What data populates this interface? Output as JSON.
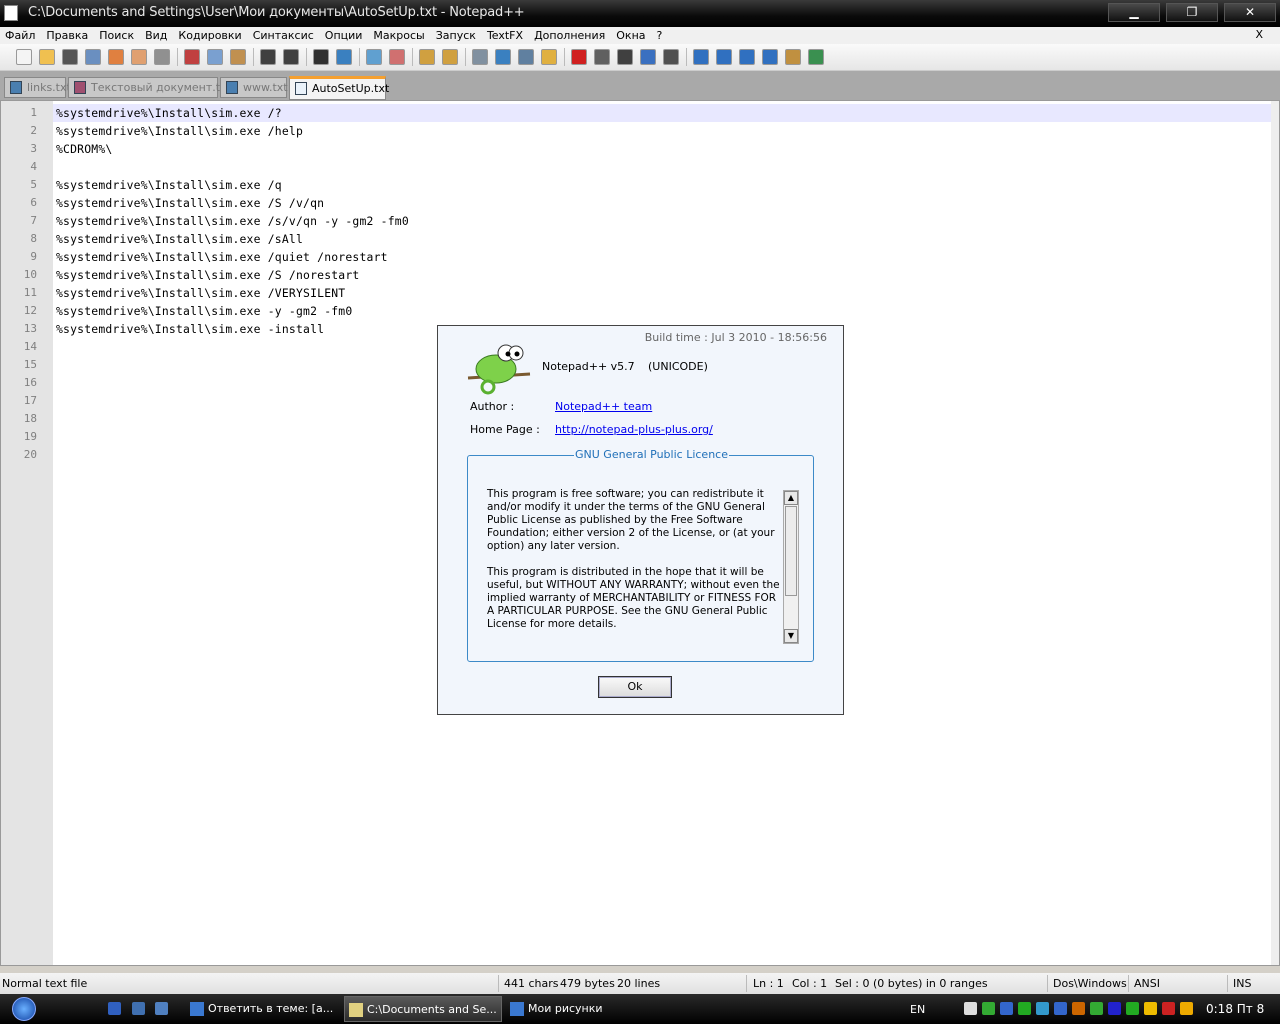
{
  "window": {
    "title": "C:\\Documents and Settings\\User\\Мои документы\\AutoSetUp.txt - Notepad++",
    "minimize": "▁",
    "maximize": "❐",
    "close": "✕"
  },
  "menu": {
    "items": [
      "Файл",
      "Правка",
      "Поиск",
      "Вид",
      "Кодировки",
      "Синтаксис",
      "Опции",
      "Макросы",
      "Запуск",
      "TextFX",
      "Дополнения",
      "Окна",
      "?"
    ],
    "close": "X"
  },
  "toolbar": {
    "icons": [
      {
        "name": "new-file-icon",
        "color": "#f4f4f4"
      },
      {
        "name": "open-file-icon",
        "color": "#f0c050"
      },
      {
        "name": "save-icon",
        "color": "#555555"
      },
      {
        "name": "save-all-icon",
        "color": "#6a8fc0"
      },
      {
        "name": "close-icon",
        "color": "#e08040"
      },
      {
        "name": "close-all-icon",
        "color": "#e0a070"
      },
      {
        "name": "print-icon",
        "color": "#909090"
      },
      "|",
      {
        "name": "cut-icon",
        "color": "#c04040"
      },
      {
        "name": "copy-icon",
        "color": "#7aa0d0"
      },
      {
        "name": "paste-icon",
        "color": "#c09050"
      },
      "|",
      {
        "name": "undo-icon",
        "color": "#404040"
      },
      {
        "name": "redo-icon",
        "color": "#404040"
      },
      "|",
      {
        "name": "find-icon",
        "color": "#303030"
      },
      {
        "name": "replace-icon",
        "color": "#3a80c0"
      },
      "|",
      {
        "name": "zoom-in-icon",
        "color": "#60a0d0"
      },
      {
        "name": "zoom-out-icon",
        "color": "#d07070"
      },
      "|",
      {
        "name": "sync-vertical-icon",
        "color": "#d0a040"
      },
      {
        "name": "sync-horizontal-icon",
        "color": "#d0a040"
      },
      "|",
      {
        "name": "word-wrap-icon",
        "color": "#8090a0"
      },
      {
        "name": "show-all-chars-icon",
        "color": "#3a80c0"
      },
      {
        "name": "indent-guide-icon",
        "color": "#6080a0"
      },
      {
        "name": "user-language-icon",
        "color": "#e0b040"
      },
      "|",
      {
        "name": "record-macro-icon",
        "color": "#d02020"
      },
      {
        "name": "stop-macro-icon",
        "color": "#606060"
      },
      {
        "name": "play-macro-icon",
        "color": "#404040"
      },
      {
        "name": "play-multiple-icon",
        "color": "#3a70c0"
      },
      {
        "name": "save-macro-icon",
        "color": "#505050"
      },
      "|",
      {
        "name": "fold-all-icon",
        "color": "#3070c0"
      },
      {
        "name": "prev-icon",
        "color": "#3070c0"
      },
      {
        "name": "next-icon",
        "color": "#3070c0"
      },
      {
        "name": "unfold-all-icon",
        "color": "#3070c0"
      },
      {
        "name": "clipboard-icon",
        "color": "#c09040"
      },
      {
        "name": "spellcheck-icon",
        "color": "#3a9050"
      }
    ]
  },
  "tabs": [
    "links.txt",
    "Текстовый документ.txt",
    "www.txt",
    "AutoSetUp.txt"
  ],
  "editor": {
    "lines": [
      "%systemdrive%\\Install\\sim.exe /?",
      "%systemdrive%\\Install\\sim.exe /help",
      "%CDROM%\\",
      "",
      "%systemdrive%\\Install\\sim.exe /q",
      "%systemdrive%\\Install\\sim.exe /S /v/qn",
      "%systemdrive%\\Install\\sim.exe /s/v/qn -y -gm2 -fm0",
      "%systemdrive%\\Install\\sim.exe /sAll",
      "%systemdrive%\\Install\\sim.exe /quiet /norestart",
      "%systemdrive%\\Install\\sim.exe /S /norestart",
      "%systemdrive%\\Install\\sim.exe /VERYSILENT",
      "%systemdrive%\\Install\\sim.exe -y -gm2 -fm0",
      "%systemdrive%\\Install\\sim.exe -install",
      "",
      "",
      "",
      "",
      "",
      "",
      ""
    ]
  },
  "about": {
    "build_time": "Build time : Jul  3 2010 - 18:56:56",
    "app": "Notepad++ v5.7",
    "encoding": "(UNICODE)",
    "author_label": "Author :",
    "author": "Notepad++ team",
    "home_label": "Home Page :",
    "home": "http://notepad-plus-plus.org/",
    "group_title": "GNU General Public Licence",
    "license": "This program is free software; you can redistribute it and/or modify it under the terms of the GNU General Public License as published by the Free Software Foundation; either version 2 of the License, or (at your option) any later version.\n\nThis program is distributed in the hope that it will be useful, but WITHOUT ANY WARRANTY; without even the implied warranty of MERCHANTABILITY or FITNESS FOR A PARTICULAR PURPOSE.  See the GNU General Public License for more details.",
    "ok": "Ok"
  },
  "status": {
    "type": "Normal text file",
    "chars": "441 chars",
    "bytes": "479 bytes",
    "lines": "20 lines",
    "ln": "Ln : 1",
    "col": "Col : 1",
    "sel": "Sel : 0 (0 bytes) in 0 ranges",
    "eol": "Dos\\Windows",
    "enc": "ANSI",
    "mode": "INS"
  },
  "taskbar": {
    "tasks": [
      "Ответить в теме: [a...",
      "C:\\Documents and Se...",
      "Мои рисунки"
    ],
    "lang": "EN",
    "clock": "0:18 Пт 8"
  }
}
